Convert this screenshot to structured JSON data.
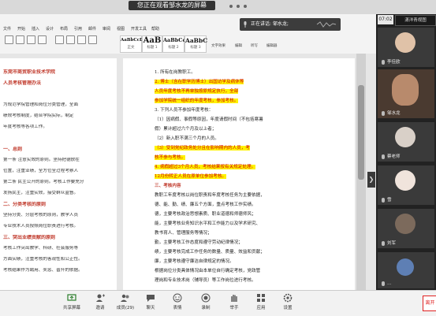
{
  "top": {
    "share_banner": "您正在观看邹水龙的屏幕"
  },
  "ribbon": {
    "menu": [
      "文件",
      "开始",
      "插入",
      "设计",
      "布局",
      "引用",
      "邮件",
      "审阅",
      "视图",
      "开发工具",
      "帮助"
    ],
    "styles": [
      {
        "sample": "AaBbCcDt",
        "caption": "正文"
      },
      {
        "sample": "AaB",
        "caption": "标题 1"
      },
      {
        "sample": "AaBbCcI",
        "caption": "标题 2"
      },
      {
        "sample": "AaBbC",
        "caption": "标题 3"
      }
    ],
    "tools": [
      "文字效果",
      "编辑",
      "听写",
      "编辑器"
    ]
  },
  "document": {
    "left_page": [
      {
        "text": "东莞市商贸职业技术学院",
        "heading": true
      },
      {
        "text": "人员考核管理办法",
        "heading": true
      },
      {
        "text": "",
        "heading": false
      },
      {
        "text": "为规范学院管理和岗位分类管理，全面",
        "heading": false
      },
      {
        "text": "绩效考核制度，结合学院实际，制定",
        "heading": false
      },
      {
        "text": "年度考核等各项工作。",
        "heading": false
      },
      {
        "text": "",
        "heading": false
      },
      {
        "text": "一、总则",
        "heading": true
      },
      {
        "text": "第一条 注意实效的原则。坚持把德放在",
        "heading": false
      },
      {
        "text": "位置，注重业绩，全方位全过程考察人",
        "heading": false
      },
      {
        "text": "第二条 民主公开的原则。考核工作要充分",
        "heading": false
      },
      {
        "text": "发扬民主，注重实效，接受群众监督。",
        "heading": false
      },
      {
        "text": "二、分类考核的原则",
        "heading": true
      },
      {
        "text": "坚持分类、分层考核的原则，教学人员",
        "heading": false
      },
      {
        "text": "专业技术人员按照岗位职责进行考核。",
        "heading": false
      },
      {
        "text": "三、突出业绩贡献的原则",
        "heading": true
      },
      {
        "text": "考核工作突出教学、科研、社会服务等",
        "heading": false
      },
      {
        "text": "方面实绩，注重考核的客观性和公正性。",
        "heading": false
      },
      {
        "text": "考核结果作为聘用、奖惩、晋升的依据。",
        "heading": false
      }
    ],
    "right_page": [
      {
        "text": "1. 所有在岗教职工。",
        "style": "normal"
      },
      {
        "text": "2. 博士（含在职学历博士）出国访学及病休等",
        "style": "hl"
      },
      {
        "text": "人员年度考核不再单独按原规定执行，全部",
        "style": "hl"
      },
      {
        "text": "参加学院统一组织的年度考核，参加考核。",
        "style": "hl"
      },
      {
        "text": "3. 下列人员不参加年度考核：",
        "style": "normal"
      },
      {
        "text": "（1）因病假、事假等原因，年度请假时间（不包括寒暑",
        "style": "normal"
      },
      {
        "text": "假）累计超过六个月及以上者；",
        "style": "normal"
      },
      {
        "text": "（2）新入职不满三个月的人员。",
        "style": "normal"
      },
      {
        "text": "（3）受到党纪政务处分且在影响期内的人员，考",
        "style": "hl"
      },
      {
        "text": "核不参与考核。",
        "style": "hl"
      },
      {
        "text": "4. 病假超过3个月人员，考核结果按有关规定处理。",
        "style": "hl"
      },
      {
        "text": "12月份转正人员在原单位参加考核。",
        "style": "hl"
      },
      {
        "text": "三、考核内容",
        "style": "sec"
      },
      {
        "text": "教职工年度考核以岗位职责和年度考核任务为主要依据，",
        "style": "normal"
      },
      {
        "text": "德、能、勤、绩、廉五个方面，重点考核工作实绩。",
        "style": "normal"
      },
      {
        "text": "德，主要考核政治思想素质、职业道德和师德师风；",
        "style": "normal"
      },
      {
        "text": "能，主要考核业务知识水平和工作能力以及学术研究、",
        "style": "normal"
      },
      {
        "text": "教书育人、管理服务等情况；",
        "style": "normal"
      },
      {
        "text": "勤，主要考核工作态度和遵守劳动纪律情况；",
        "style": "normal"
      },
      {
        "text": "绩，主要考核完成工作任务的数量、质量、效益和贡献；",
        "style": "normal"
      },
      {
        "text": "廉，主要考核遵守廉洁自律规定的情况。",
        "style": "normal"
      },
      {
        "text": "根据岗位分类具体情况由本单位自行确定考核，党政管",
        "style": "normal"
      },
      {
        "text": "理岗和专业技术岗（辅导员）等工作岗位进行考核。",
        "style": "normal"
      }
    ]
  },
  "panel": {
    "time": "07:02",
    "host_tag": "潇洋青视图",
    "speaking": "正在讲话: 邹水龙;",
    "participants": [
      {
        "name": "李佳欧"
      },
      {
        "name": "邹水龙"
      },
      {
        "name": "蔡老师"
      },
      {
        "name": "雪"
      },
      {
        "name": "刘军"
      },
      {
        "name": "…"
      }
    ]
  },
  "bottom": {
    "buttons": [
      {
        "label": "共享屏幕",
        "icon": "share-screen-icon"
      },
      {
        "label": "邀请",
        "icon": "invite-icon"
      },
      {
        "label": "成员(29)",
        "icon": "members-icon"
      },
      {
        "label": "聊天",
        "icon": "chat-icon"
      },
      {
        "label": "表情",
        "icon": "emoji-icon"
      },
      {
        "label": "录制",
        "icon": "record-icon"
      },
      {
        "label": "举手",
        "icon": "raise-hand-icon"
      },
      {
        "label": "应用",
        "icon": "apps-icon"
      },
      {
        "label": "设置",
        "icon": "settings-icon"
      }
    ],
    "end_label": "离开"
  },
  "colors": {
    "highlight": "#fff200",
    "highlight_text": "#d10000",
    "heading": "#c0392b"
  }
}
